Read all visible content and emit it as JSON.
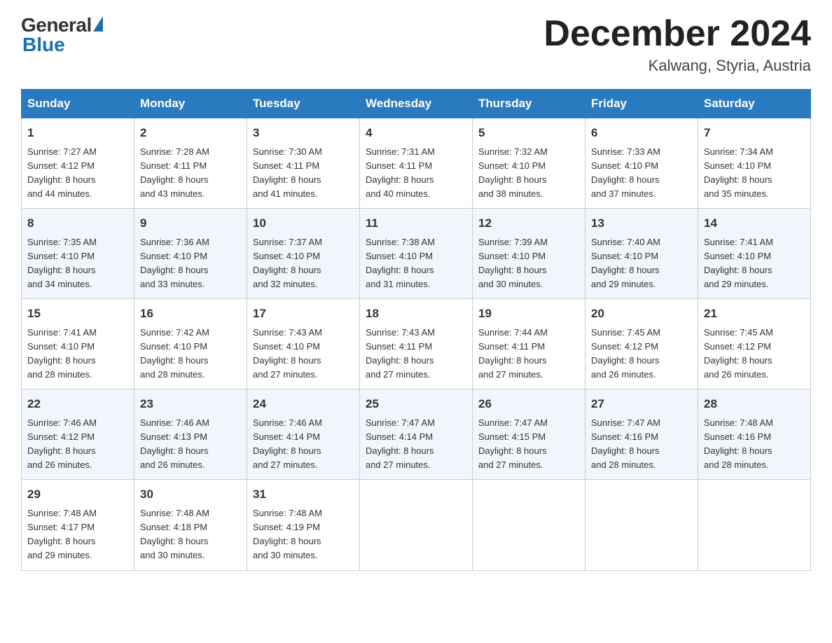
{
  "header": {
    "logo_general": "General",
    "logo_blue": "Blue",
    "month_title": "December 2024",
    "location": "Kalwang, Styria, Austria"
  },
  "days_of_week": [
    "Sunday",
    "Monday",
    "Tuesday",
    "Wednesday",
    "Thursday",
    "Friday",
    "Saturday"
  ],
  "weeks": [
    [
      {
        "day": "1",
        "sunrise": "7:27 AM",
        "sunset": "4:12 PM",
        "daylight": "8 hours and 44 minutes."
      },
      {
        "day": "2",
        "sunrise": "7:28 AM",
        "sunset": "4:11 PM",
        "daylight": "8 hours and 43 minutes."
      },
      {
        "day": "3",
        "sunrise": "7:30 AM",
        "sunset": "4:11 PM",
        "daylight": "8 hours and 41 minutes."
      },
      {
        "day": "4",
        "sunrise": "7:31 AM",
        "sunset": "4:11 PM",
        "daylight": "8 hours and 40 minutes."
      },
      {
        "day": "5",
        "sunrise": "7:32 AM",
        "sunset": "4:10 PM",
        "daylight": "8 hours and 38 minutes."
      },
      {
        "day": "6",
        "sunrise": "7:33 AM",
        "sunset": "4:10 PM",
        "daylight": "8 hours and 37 minutes."
      },
      {
        "day": "7",
        "sunrise": "7:34 AM",
        "sunset": "4:10 PM",
        "daylight": "8 hours and 35 minutes."
      }
    ],
    [
      {
        "day": "8",
        "sunrise": "7:35 AM",
        "sunset": "4:10 PM",
        "daylight": "8 hours and 34 minutes."
      },
      {
        "day": "9",
        "sunrise": "7:36 AM",
        "sunset": "4:10 PM",
        "daylight": "8 hours and 33 minutes."
      },
      {
        "day": "10",
        "sunrise": "7:37 AM",
        "sunset": "4:10 PM",
        "daylight": "8 hours and 32 minutes."
      },
      {
        "day": "11",
        "sunrise": "7:38 AM",
        "sunset": "4:10 PM",
        "daylight": "8 hours and 31 minutes."
      },
      {
        "day": "12",
        "sunrise": "7:39 AM",
        "sunset": "4:10 PM",
        "daylight": "8 hours and 30 minutes."
      },
      {
        "day": "13",
        "sunrise": "7:40 AM",
        "sunset": "4:10 PM",
        "daylight": "8 hours and 29 minutes."
      },
      {
        "day": "14",
        "sunrise": "7:41 AM",
        "sunset": "4:10 PM",
        "daylight": "8 hours and 29 minutes."
      }
    ],
    [
      {
        "day": "15",
        "sunrise": "7:41 AM",
        "sunset": "4:10 PM",
        "daylight": "8 hours and 28 minutes."
      },
      {
        "day": "16",
        "sunrise": "7:42 AM",
        "sunset": "4:10 PM",
        "daylight": "8 hours and 28 minutes."
      },
      {
        "day": "17",
        "sunrise": "7:43 AM",
        "sunset": "4:10 PM",
        "daylight": "8 hours and 27 minutes."
      },
      {
        "day": "18",
        "sunrise": "7:43 AM",
        "sunset": "4:11 PM",
        "daylight": "8 hours and 27 minutes."
      },
      {
        "day": "19",
        "sunrise": "7:44 AM",
        "sunset": "4:11 PM",
        "daylight": "8 hours and 27 minutes."
      },
      {
        "day": "20",
        "sunrise": "7:45 AM",
        "sunset": "4:12 PM",
        "daylight": "8 hours and 26 minutes."
      },
      {
        "day": "21",
        "sunrise": "7:45 AM",
        "sunset": "4:12 PM",
        "daylight": "8 hours and 26 minutes."
      }
    ],
    [
      {
        "day": "22",
        "sunrise": "7:46 AM",
        "sunset": "4:12 PM",
        "daylight": "8 hours and 26 minutes."
      },
      {
        "day": "23",
        "sunrise": "7:46 AM",
        "sunset": "4:13 PM",
        "daylight": "8 hours and 26 minutes."
      },
      {
        "day": "24",
        "sunrise": "7:46 AM",
        "sunset": "4:14 PM",
        "daylight": "8 hours and 27 minutes."
      },
      {
        "day": "25",
        "sunrise": "7:47 AM",
        "sunset": "4:14 PM",
        "daylight": "8 hours and 27 minutes."
      },
      {
        "day": "26",
        "sunrise": "7:47 AM",
        "sunset": "4:15 PM",
        "daylight": "8 hours and 27 minutes."
      },
      {
        "day": "27",
        "sunrise": "7:47 AM",
        "sunset": "4:16 PM",
        "daylight": "8 hours and 28 minutes."
      },
      {
        "day": "28",
        "sunrise": "7:48 AM",
        "sunset": "4:16 PM",
        "daylight": "8 hours and 28 minutes."
      }
    ],
    [
      {
        "day": "29",
        "sunrise": "7:48 AM",
        "sunset": "4:17 PM",
        "daylight": "8 hours and 29 minutes."
      },
      {
        "day": "30",
        "sunrise": "7:48 AM",
        "sunset": "4:18 PM",
        "daylight": "8 hours and 30 minutes."
      },
      {
        "day": "31",
        "sunrise": "7:48 AM",
        "sunset": "4:19 PM",
        "daylight": "8 hours and 30 minutes."
      },
      null,
      null,
      null,
      null
    ]
  ],
  "labels": {
    "sunrise_prefix": "Sunrise: ",
    "sunset_prefix": "Sunset: ",
    "daylight_prefix": "Daylight: "
  }
}
